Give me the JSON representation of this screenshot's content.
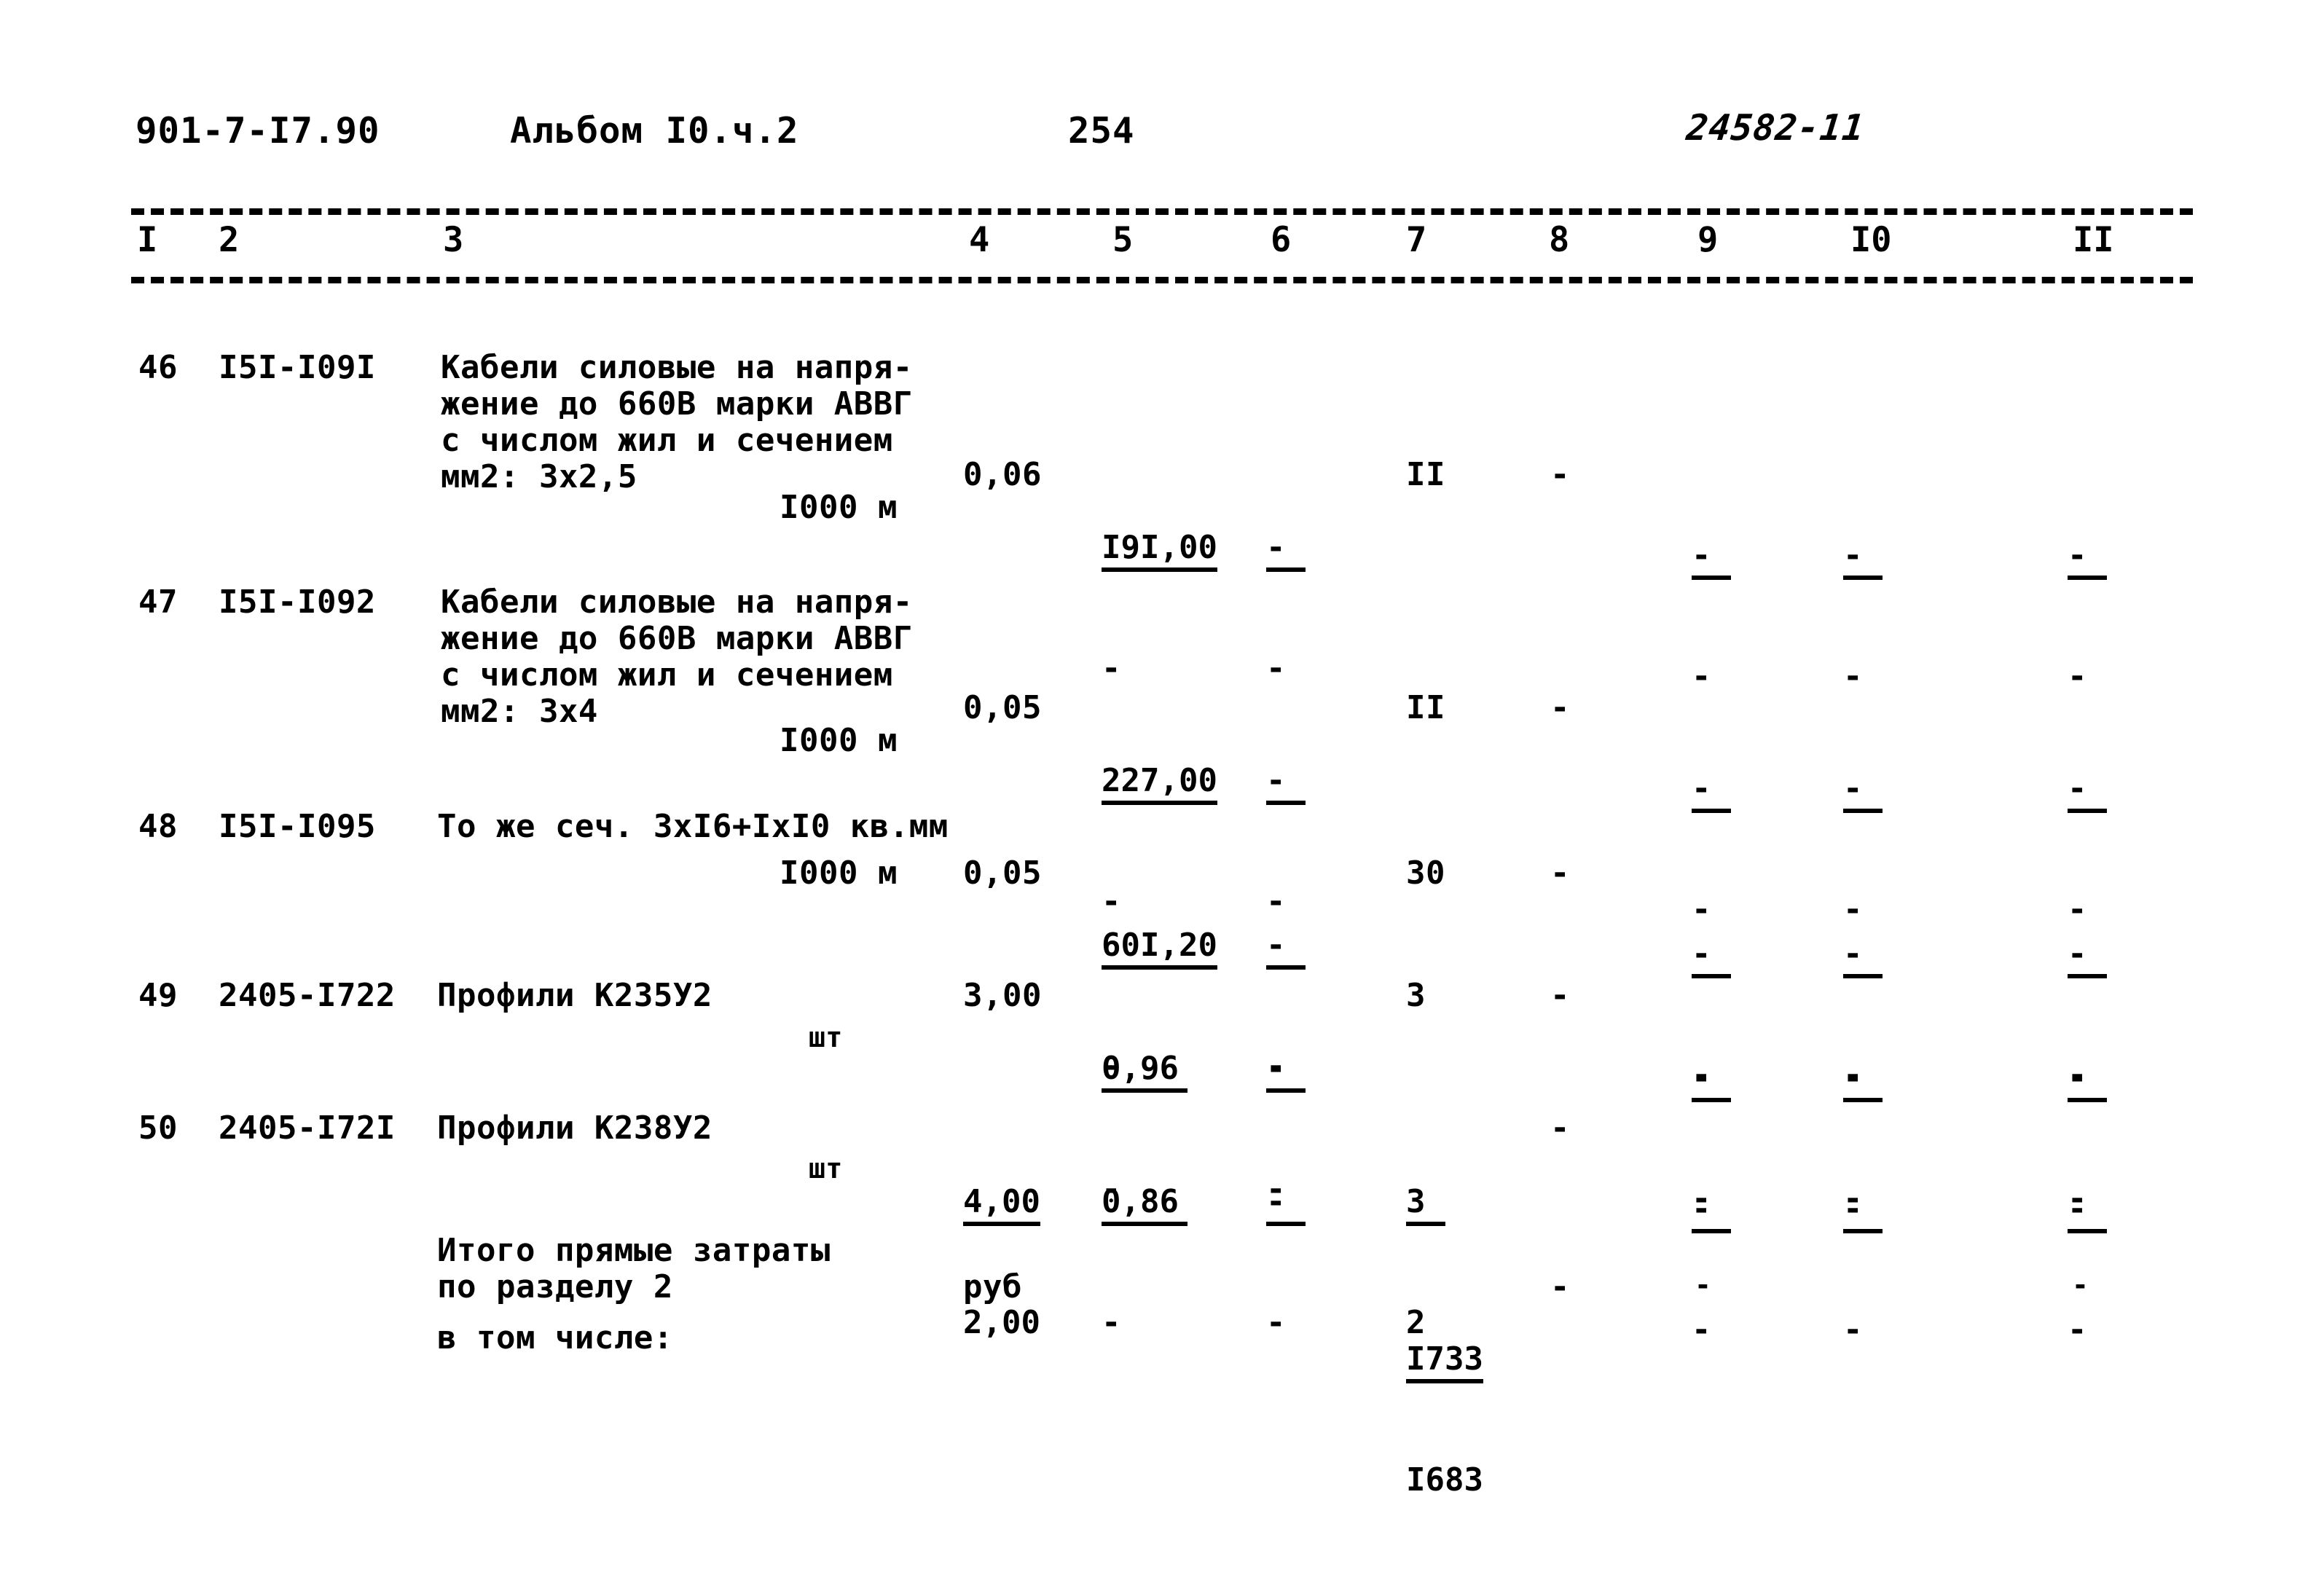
{
  "header": {
    "doc_code": "901-7-I7.90",
    "album": "Альбом I0.ч.2",
    "page_number": "254",
    "stamp": "24582-11"
  },
  "column_headers": [
    "I",
    "2",
    "3",
    "4",
    "5",
    "6",
    "7",
    "8",
    "9",
    "I0",
    "II"
  ],
  "rows": [
    {
      "no": "46",
      "code": "I5I-I09I",
      "desc_lines": [
        "Кабели силовые на напря-",
        "жение до 660В марки АВВГ",
        "с числом жил и сечением",
        "мм2: 3х2,5"
      ],
      "unit": "I000 м",
      "c4": "0,06",
      "c5_num": "I9I,00",
      "c5_den": "-",
      "c6_num": "-",
      "c6_den": "-",
      "c7": "II",
      "c8": "-",
      "c9_num": "-",
      "c9_den": "-",
      "c10_num": "-",
      "c10_den": "-",
      "c11_num": "-",
      "c11_den": "-"
    },
    {
      "no": "47",
      "code": "I5I-I092",
      "desc_lines": [
        "Кабели силовые на напря-",
        "жение до 660В марки АВВГ",
        "с числом жил и сечением",
        "мм2: 3х4"
      ],
      "unit": "I000 м",
      "c4": "0,05",
      "c5_num": "227,00",
      "c5_den": "-",
      "c6_num": "-",
      "c6_den": "-",
      "c7": "II",
      "c8": "-",
      "c9_num": "-",
      "c9_den": "-",
      "c10_num": "-",
      "c10_den": "-",
      "c11_num": "-",
      "c11_den": "-"
    },
    {
      "no": "48",
      "code": "I5I-I095",
      "desc_lines": [
        "То же сеч. 3хI6+IхI0 кв.мм"
      ],
      "unit": "I000 м",
      "c4": "0,05",
      "c5_num": "60I,20",
      "c5_den": "-",
      "c6_num": "-",
      "c6_den": "-",
      "c7": "30",
      "c8": "-",
      "c9_num": "-",
      "c9_den": "-",
      "c10_num": "-",
      "c10_den": "-",
      "c11_num": "-",
      "c11_den": "-"
    },
    {
      "no": "49",
      "code": "2405-I722",
      "desc_lines": [
        "Профили К235У2"
      ],
      "unit": "шт",
      "c4": "3,00",
      "c5_num": "0,96",
      "c5_den": "-",
      "c6_num": "-",
      "c6_den": "-",
      "c7": "3",
      "c8": "-",
      "c9_num": "-",
      "c9_den": "-",
      "c10_num": "-",
      "c10_den": "-",
      "c11_num": "-",
      "c11_den": "-"
    },
    {
      "no": "50",
      "code": "2405-I72I",
      "desc_lines": [
        "Профили К238У2"
      ],
      "unit": "шт",
      "c4_num": "4,00",
      "c4_den": "2,00",
      "c5_num": "0,86",
      "c5_den": "-",
      "c6_num": "-",
      "c6_den": "-",
      "c7_num": "3",
      "c7_den": "2",
      "c8": "-",
      "c9_num": "-",
      "c9_den": "-",
      "c10_num": "-",
      "c10_den": "-",
      "c11_num": "-",
      "c11_den": "-"
    }
  ],
  "totals": {
    "label_lines": [
      "Итого прямые затраты",
      "по разделу 2"
    ],
    "sub_label": "в том числе:",
    "unit": "руб",
    "c7_num": "I733",
    "c7_den": "I683",
    "c8": "-",
    "c9": "-",
    "c11": "-"
  }
}
